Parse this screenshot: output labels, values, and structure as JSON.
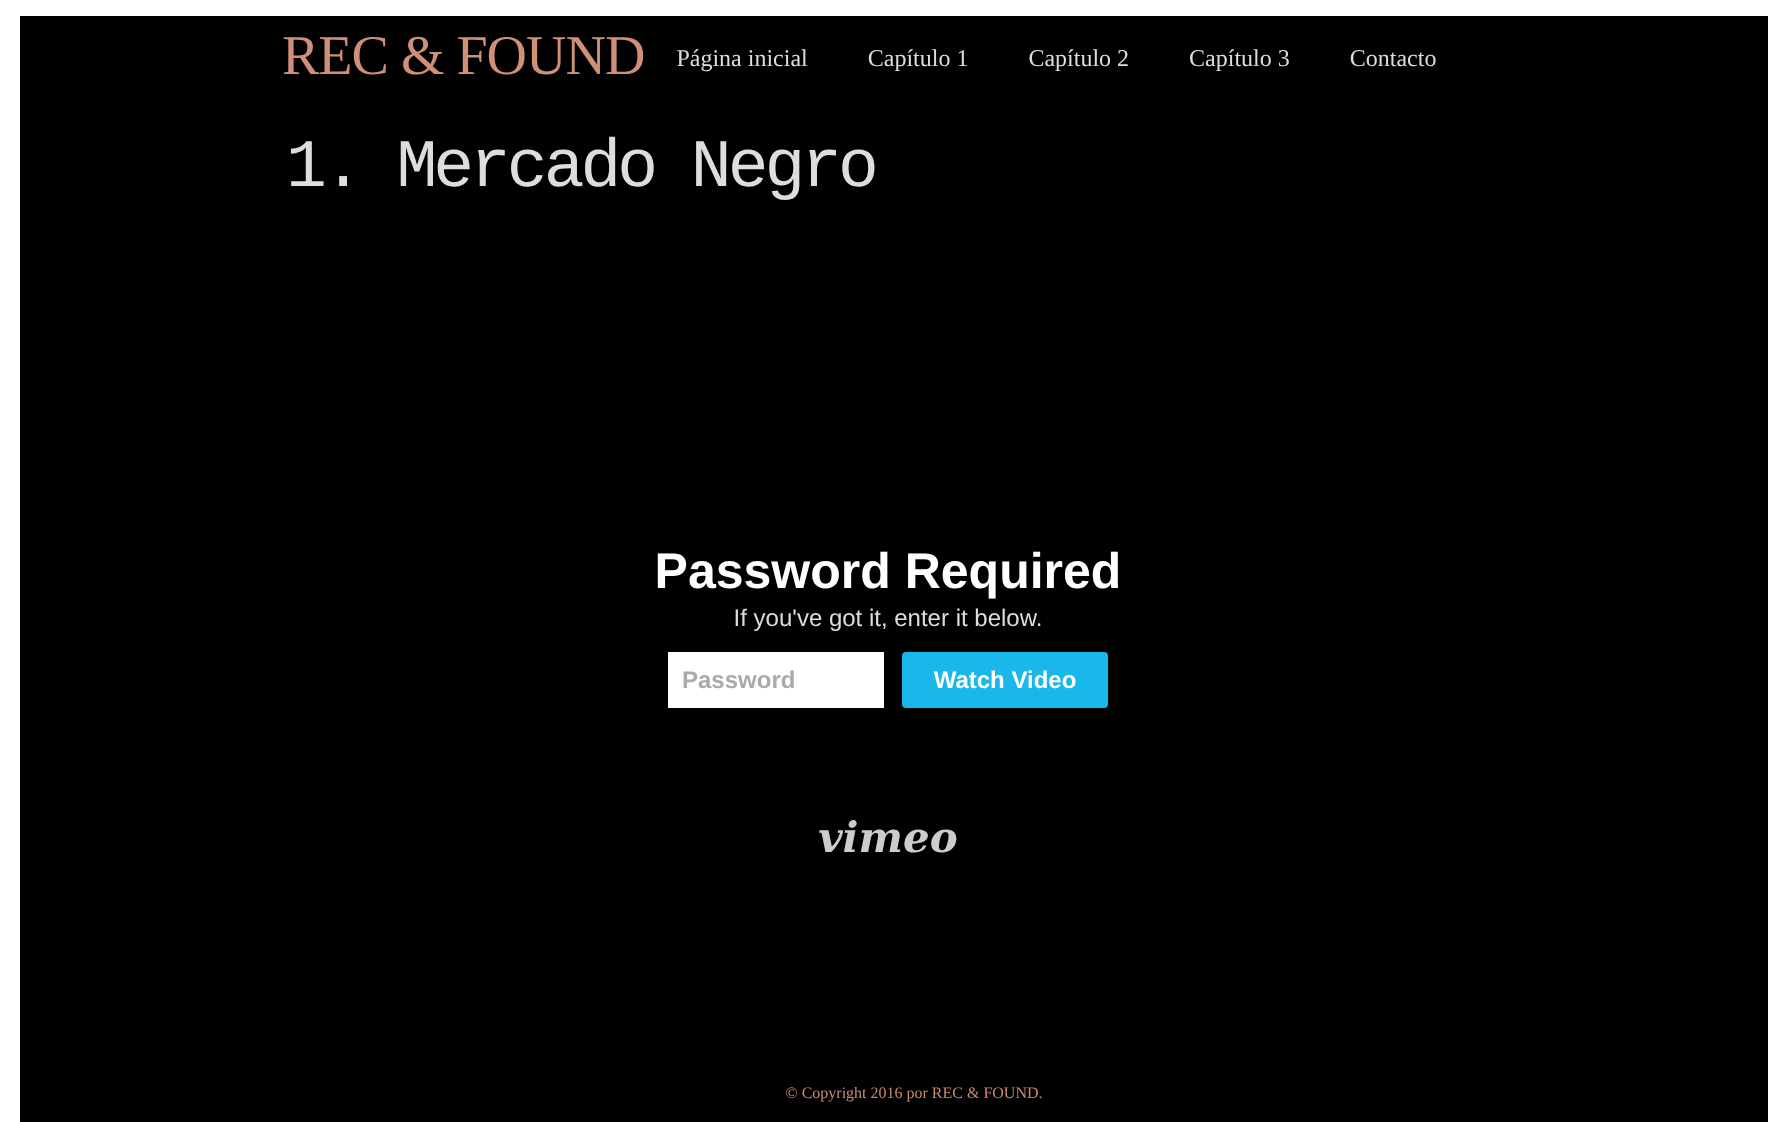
{
  "header": {
    "logo": "REC & FOUND",
    "nav": [
      {
        "label": "Página inicial"
      },
      {
        "label": "Capítulo 1"
      },
      {
        "label": "Capítulo 2"
      },
      {
        "label": "Capítulo 3"
      },
      {
        "label": "Contacto"
      }
    ]
  },
  "page_title": "1. Mercado Negro",
  "video": {
    "heading": "Password Required",
    "subtext": "If you've got it, enter it below.",
    "password": {
      "placeholder": "Password"
    },
    "button": "Watch Video",
    "logo": "vimeo"
  },
  "footer": "© Copyright 2016 por REC & FOUND."
}
